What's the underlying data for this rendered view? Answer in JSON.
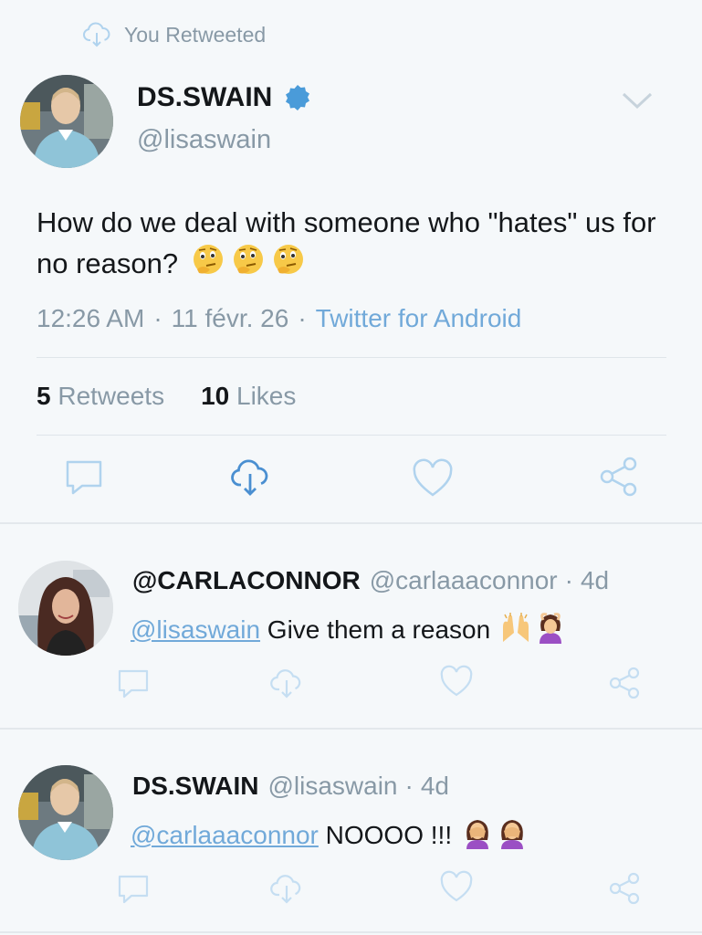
{
  "retweet_context": {
    "label": "You Retweeted",
    "icon": "retweet-icon"
  },
  "main_tweet": {
    "display_name": "DS.SWAIN",
    "handle": "@lisaswain",
    "verified": true,
    "text": "How do we deal with someone who \"hates\" us for no reason?",
    "emojis": [
      "thinking-face",
      "thinking-face",
      "thinking-face"
    ],
    "time": "12:26 AM",
    "date": "11 févr. 26",
    "source": "Twitter for Android",
    "separator": "·",
    "retweet_count": "5",
    "retweet_label": "Retweets",
    "like_count": "10",
    "like_label": "Likes",
    "actions": [
      "reply-icon",
      "retweet-icon",
      "heart-icon",
      "share-icon"
    ]
  },
  "replies": [
    {
      "display_name": "@CARLACONNOR",
      "handle": "@carlaaaconnor",
      "separator": "·",
      "age": "4d",
      "mention": "@lisaswain",
      "text": " Give them a reason",
      "emojis": [
        "raising-hands",
        "woman-gesturing-ok"
      ]
    },
    {
      "display_name": "DS.SWAIN",
      "handle": "@lisaswain",
      "separator": "·",
      "age": "4d",
      "mention": "@carlaaaconnor",
      "text": " NOOOO !!!",
      "emojis": [
        "woman-facepalming",
        "woman-facepalming"
      ]
    }
  ],
  "colors": {
    "background": "#f5f8fa",
    "text": "#14171a",
    "secondary": "#8899a6",
    "link": "#71a9d9",
    "icon": "#b0d3ee",
    "retweet_active": "#4a8fd1",
    "verified": "#4a9bd9"
  }
}
